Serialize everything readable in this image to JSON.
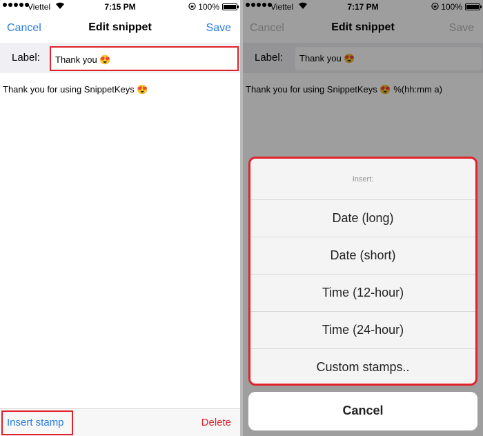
{
  "left": {
    "status": {
      "carrier": "Viettel",
      "time": "7:15 PM",
      "battery": "100%"
    },
    "nav": {
      "cancel": "Cancel",
      "title": "Edit snippet",
      "save": "Save"
    },
    "label_caption": "Label:",
    "label_value": "Thank you 😍",
    "body": "Thank you for using SnippetKeys 😍",
    "toolbar": {
      "insert_stamp": "Insert stamp",
      "delete": "Delete"
    }
  },
  "right": {
    "status": {
      "carrier": "Viettel",
      "time": "7:17 PM",
      "battery": "100%"
    },
    "nav": {
      "cancel": "Cancel",
      "title": "Edit snippet",
      "save": "Save"
    },
    "label_caption": "Label:",
    "label_value": "Thank you 😍",
    "body": "Thank you for using SnippetKeys 😍 %(hh:mm a)",
    "sheet": {
      "title": "Insert:",
      "options": [
        "Date (long)",
        "Date (short)",
        "Time (12-hour)",
        "Time (24-hour)",
        "Custom stamps.."
      ]
    },
    "cancel": "Cancel"
  },
  "colors": {
    "accent": "#2b7de1",
    "highlight": "#e0222a",
    "destructive": "#e0222a"
  }
}
